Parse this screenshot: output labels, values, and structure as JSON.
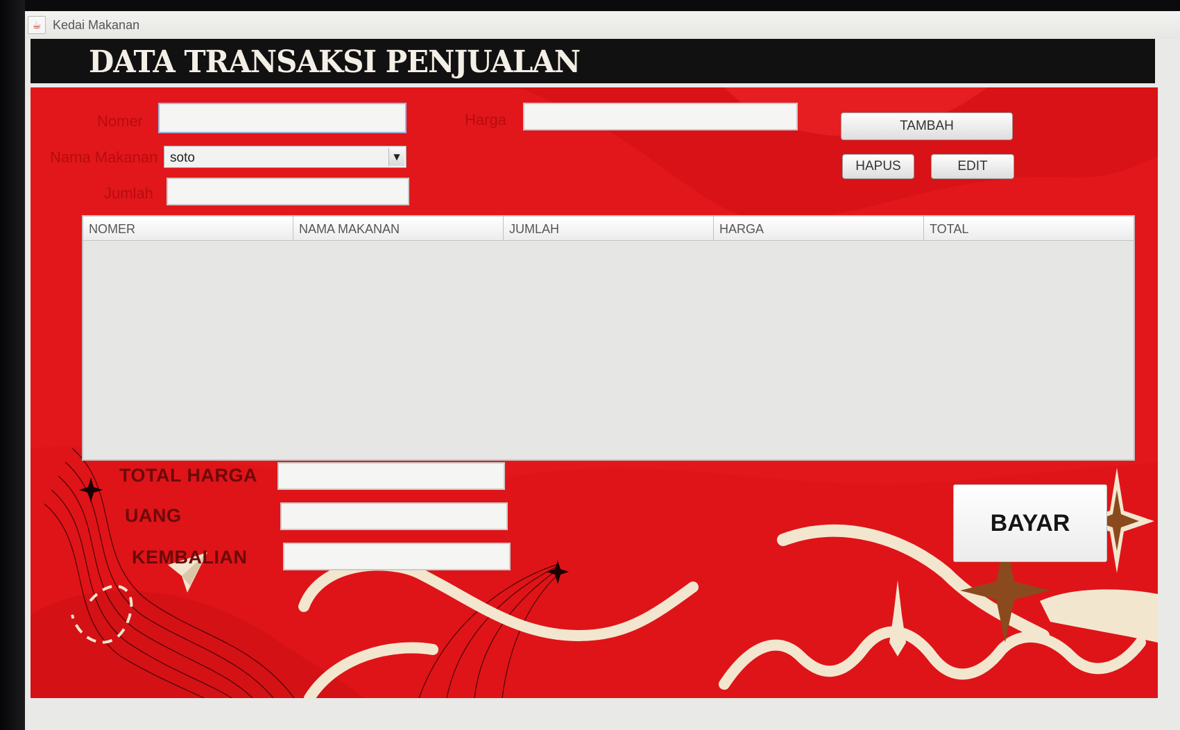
{
  "window": {
    "title": "Kedai Makanan",
    "icon": "java-cup-icon"
  },
  "header": {
    "title": "DATA TRANSAKSI PENJUALAN"
  },
  "form": {
    "nomer_label": "Nomer",
    "nomer_value": "",
    "nama_makanan_label": "Nama Makanan",
    "nama_makanan_selected": "soto",
    "jumlah_label": "Jumlah",
    "jumlah_value": "",
    "harga_label": "Harga",
    "harga_value": ""
  },
  "buttons": {
    "tambah": "TAMBAH",
    "hapus": "HAPUS",
    "edit": "EDIT",
    "bayar": "BAYAR"
  },
  "table": {
    "columns": [
      "NOMER",
      "NAMA MAKANAN",
      "JUMLAH",
      "HARGA",
      "TOTAL"
    ],
    "rows": []
  },
  "summary": {
    "total_harga_label": "TOTAL HARGA",
    "total_harga_value": "",
    "uang_label": "UANG",
    "uang_value": "",
    "kembalian_label": "KEMBALIAN",
    "kembalian_value": ""
  },
  "colors": {
    "panel_red": "#e2171b",
    "header_black": "#121112",
    "label_red": "#b70c0e",
    "cream": "#f3e6cf"
  }
}
